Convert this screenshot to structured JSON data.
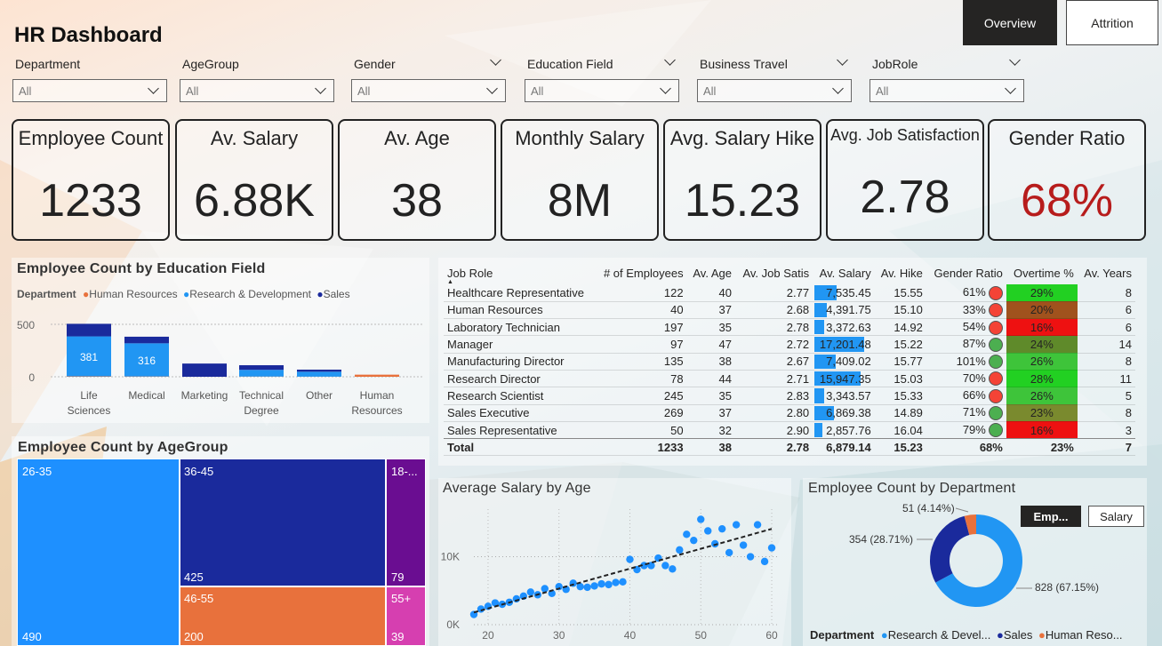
{
  "title": "HR Dashboard",
  "nav": {
    "overview": "Overview",
    "attrition": "Attrition"
  },
  "filters": [
    {
      "label": "Department",
      "value": "All"
    },
    {
      "label": "AgeGroup",
      "value": "All"
    },
    {
      "label": "Gender",
      "value": "All"
    },
    {
      "label": "Education Field",
      "value": "All"
    },
    {
      "label": "Business Travel",
      "value": "All"
    },
    {
      "label": "JobRole",
      "value": "All"
    }
  ],
  "kpis": [
    {
      "label": "Employee Count",
      "value": "1233"
    },
    {
      "label": "Av. Salary",
      "value": "6.88K"
    },
    {
      "label": "Av. Age",
      "value": "38"
    },
    {
      "label": "Monthly Salary",
      "value": "8M"
    },
    {
      "label": "Avg. Salary Hike",
      "value": "15.23"
    },
    {
      "label": "Avg. Job Satisfaction",
      "value": "2.78"
    },
    {
      "label": "Gender Ratio",
      "value": "68%"
    }
  ],
  "colors": {
    "hr": "#E8713C",
    "rd": "#2196F3",
    "sales": "#1A2A9C",
    "gender_ratio": "#B71C1C",
    "green": "#4CAF50",
    "red": "#F44336"
  },
  "edu_chart": {
    "title": "Employee Count by Education Field",
    "legend_title": "Department",
    "legend": [
      "Human Resources",
      "Research & Development",
      "Sales"
    ]
  },
  "age_chart": {
    "title": "Employee Count by AgeGroup"
  },
  "scatter_chart": {
    "title": "Average Salary by Age"
  },
  "donut_chart": {
    "title": "Employee Count by Department",
    "toggle_emp": "Emp...",
    "toggle_salary": "Salary",
    "legend_title": "Department",
    "legend": [
      "Research & Devel...",
      "Sales",
      "Human Reso..."
    ]
  },
  "table": {
    "headers": [
      "Job Role",
      "# of Employees",
      "Av. Age",
      "Av. Job Satis",
      "Av. Salary",
      "Av. Hike",
      "Gender Ratio",
      "Overtime %",
      "Av. Years"
    ],
    "rows": [
      [
        "Healthcare Representative",
        "122",
        "40",
        "2.77",
        "7,535.45",
        "15.55",
        "61%",
        "29%",
        "8"
      ],
      [
        "Human Resources",
        "40",
        "37",
        "2.68",
        "4,391.75",
        "15.10",
        "33%",
        "20%",
        "6"
      ],
      [
        "Laboratory Technician",
        "197",
        "35",
        "2.78",
        "3,372.63",
        "14.92",
        "54%",
        "16%",
        "6"
      ],
      [
        "Manager",
        "97",
        "47",
        "2.72",
        "17,201.48",
        "15.22",
        "87%",
        "24%",
        "14"
      ],
      [
        "Manufacturing Director",
        "135",
        "38",
        "2.67",
        "7,409.02",
        "15.77",
        "101%",
        "26%",
        "8"
      ],
      [
        "Research Director",
        "78",
        "44",
        "2.71",
        "15,947.35",
        "15.03",
        "70%",
        "28%",
        "11"
      ],
      [
        "Research Scientist",
        "245",
        "35",
        "2.83",
        "3,343.57",
        "15.33",
        "66%",
        "26%",
        "5"
      ],
      [
        "Sales Executive",
        "269",
        "37",
        "2.80",
        "6,869.38",
        "14.89",
        "71%",
        "23%",
        "8"
      ],
      [
        "Sales Representative",
        "50",
        "32",
        "2.90",
        "2,857.76",
        "16.04",
        "79%",
        "16%",
        "3"
      ]
    ],
    "total": [
      "Total",
      "1233",
      "38",
      "2.78",
      "6,879.14",
      "15.23",
      "68%",
      "23%",
      "7"
    ],
    "gender_status": [
      "red",
      "red",
      "red",
      "green",
      "green",
      "red",
      "red",
      "green",
      "green"
    ],
    "overtime_colors": [
      "#22d022",
      "#a0521d",
      "#ee1111",
      "#5f8a2a",
      "#3ec43a",
      "#22d022",
      "#3ec43a",
      "#7a8a2e",
      "#ee1111"
    ]
  },
  "chart_data": [
    {
      "type": "bar",
      "title": "Employee Count by Education Field",
      "categories": [
        "Life Sciences",
        "Medical",
        "Marketing",
        "Technical Degree",
        "Other",
        "Human Resources"
      ],
      "series": [
        {
          "name": "Human Resources",
          "values": [
            4,
            3,
            0,
            2,
            1,
            20
          ]
        },
        {
          "name": "Research & Development",
          "values": [
            381,
            316,
            0,
            64,
            47,
            0
          ]
        },
        {
          "name": "Sales",
          "values": [
            120,
            63,
            126,
            44,
            20,
            0
          ]
        }
      ],
      "ylim": [
        0,
        500
      ],
      "yticks": [
        "0",
        "500"
      ],
      "data_labels": [
        "381",
        "316"
      ]
    },
    {
      "type": "heatmap",
      "title": "Employee Count by AgeGroup",
      "categories": [
        "26-35",
        "36-45",
        "18-...",
        "46-55",
        "55+"
      ],
      "values": [
        490,
        425,
        79,
        200,
        39
      ]
    },
    {
      "type": "scatter",
      "title": "Average Salary by Age",
      "xlim": [
        18,
        61
      ],
      "ylim": [
        0,
        17000
      ],
      "xticks": [
        "20",
        "30",
        "40",
        "50",
        "60"
      ],
      "yticks": [
        "0K",
        "10K"
      ],
      "x": [
        18,
        19,
        20,
        21,
        22,
        23,
        24,
        25,
        26,
        27,
        28,
        29,
        30,
        31,
        32,
        33,
        34,
        35,
        36,
        37,
        38,
        39,
        40,
        41,
        42,
        43,
        44,
        45,
        46,
        47,
        48,
        49,
        50,
        51,
        52,
        53,
        54,
        55,
        56,
        57,
        58,
        59,
        60
      ],
      "y": [
        1500,
        2300,
        2700,
        3200,
        3000,
        3300,
        3800,
        4200,
        4800,
        4400,
        5300,
        4600,
        5600,
        5200,
        6100,
        5600,
        5500,
        5700,
        6000,
        5900,
        6200,
        6300,
        9600,
        8100,
        8700,
        8700,
        9800,
        8700,
        8200,
        11000,
        13300,
        12400,
        15500,
        13800,
        11900,
        14100,
        10600,
        14700,
        11700,
        10000,
        14700,
        9300,
        11300
      ],
      "trend": [
        [
          18,
          1800
        ],
        [
          60,
          14100
        ]
      ]
    },
    {
      "type": "pie",
      "title": "Employee Count by Department",
      "categories": [
        "Research & Development",
        "Sales",
        "Human Resources"
      ],
      "values": [
        828,
        354,
        51
      ],
      "labels": [
        "828 (67.15%)",
        "354 (28.71%)",
        "51 (4.14%)"
      ]
    }
  ]
}
